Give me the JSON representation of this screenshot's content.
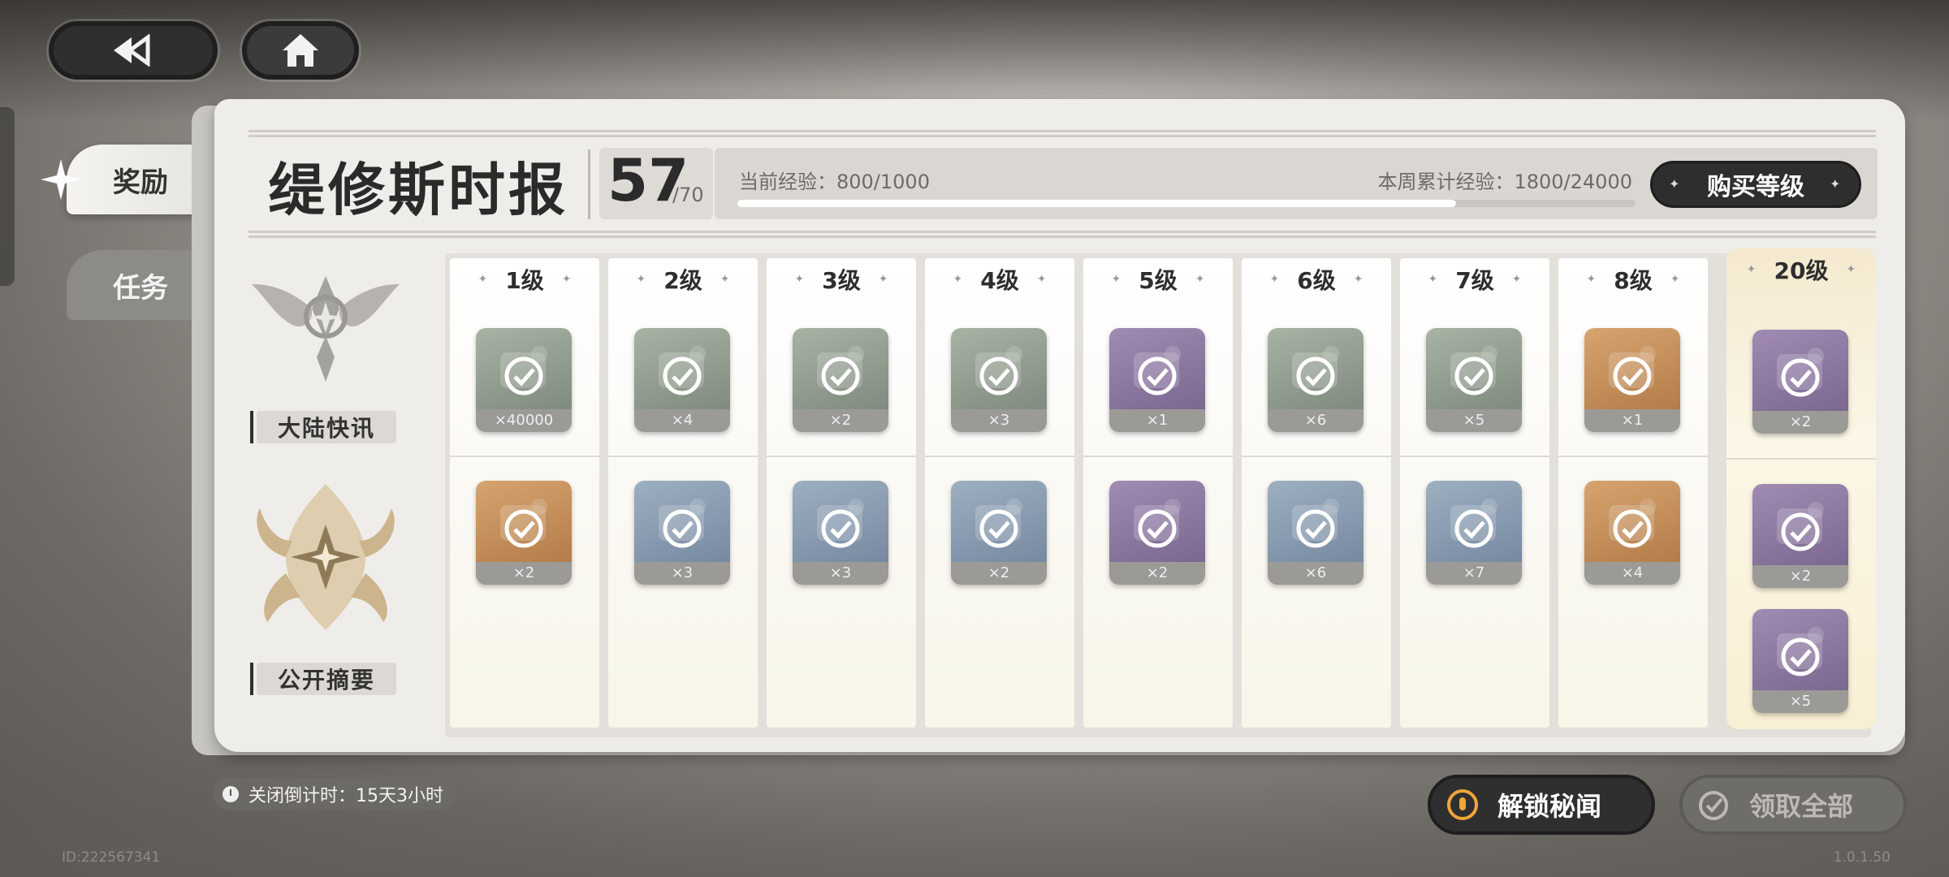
{
  "nav": {
    "back_icon": "back-icon",
    "home_icon": "home-icon"
  },
  "tabs": [
    {
      "label": "奖励",
      "active": true
    },
    {
      "label": "任务",
      "active": false
    }
  ],
  "header": {
    "title": "缇修斯时报",
    "level": "57",
    "level_max": "/70",
    "current_exp_label": "当前经验：800/1000",
    "weekly_exp_label": "本周累计经验：1800/24000",
    "exp_progress": 0.8,
    "buy_level_label": "购买等级"
  },
  "tracks": [
    {
      "label": "大陆快讯"
    },
    {
      "label": "公开摘要"
    }
  ],
  "levels": [
    {
      "label": "1级",
      "free": {
        "count": "×40000",
        "color": "green"
      },
      "premium": [
        {
          "count": "×2",
          "color": "orange"
        }
      ]
    },
    {
      "label": "2级",
      "free": {
        "count": "×4",
        "color": "green"
      },
      "premium": [
        {
          "count": "×3",
          "color": "blue"
        }
      ]
    },
    {
      "label": "3级",
      "free": {
        "count": "×2",
        "color": "green"
      },
      "premium": [
        {
          "count": "×3",
          "color": "blue"
        }
      ]
    },
    {
      "label": "4级",
      "free": {
        "count": "×3",
        "color": "green"
      },
      "premium": [
        {
          "count": "×2",
          "color": "blue"
        }
      ]
    },
    {
      "label": "5级",
      "free": {
        "count": "×1",
        "color": "purple"
      },
      "premium": [
        {
          "count": "×2",
          "color": "purple"
        }
      ]
    },
    {
      "label": "6级",
      "free": {
        "count": "×6",
        "color": "green"
      },
      "premium": [
        {
          "count": "×6",
          "color": "blue"
        }
      ]
    },
    {
      "label": "7级",
      "free": {
        "count": "×5",
        "color": "green"
      },
      "premium": [
        {
          "count": "×7",
          "color": "blue"
        }
      ]
    },
    {
      "label": "8级",
      "free": {
        "count": "×1",
        "color": "orange"
      },
      "premium": [
        {
          "count": "×4",
          "color": "orange"
        }
      ]
    },
    {
      "label": "20级",
      "free": {
        "count": "×2",
        "color": "purple"
      },
      "premium": [
        {
          "count": "×2",
          "color": "purple"
        },
        {
          "count": "×5",
          "color": "purple"
        }
      ]
    }
  ],
  "footer": {
    "countdown": "关闭倒计时：15天3小时",
    "unlock_label": "解锁秘闻",
    "claim_all_label": "领取全部",
    "id_text": "ID:222567341",
    "version": "1.0.1.50"
  }
}
